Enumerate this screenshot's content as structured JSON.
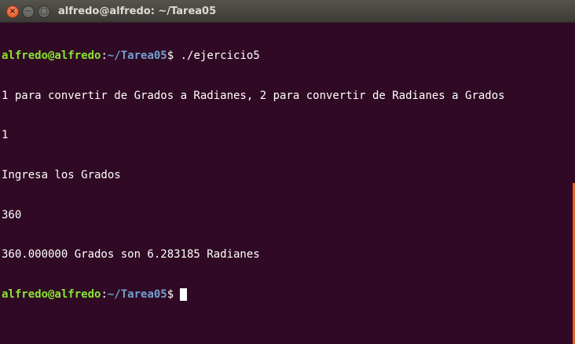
{
  "window": {
    "title": "alfredo@alfredo: ~/Tarea05",
    "close_glyph": "×",
    "minimize_glyph": "−",
    "maximize_glyph": "□"
  },
  "terminal": {
    "prompt_user": "alfredo@alfredo",
    "prompt_sep": ":",
    "prompt_path": "~/Tarea05",
    "prompt_symbol": "$",
    "command": " ./ejercicio5",
    "output": [
      "1 para convertir de Grados a Radianes, 2 para convertir de Radianes a Grados",
      "1",
      "Ingresa los Grados",
      "360",
      "360.000000 Grados son 6.283185 Radianes"
    ]
  },
  "colors": {
    "background": "#300a24",
    "prompt_user": "#8ae234",
    "prompt_path": "#729fcf",
    "scrollbar": "#e0612a"
  }
}
